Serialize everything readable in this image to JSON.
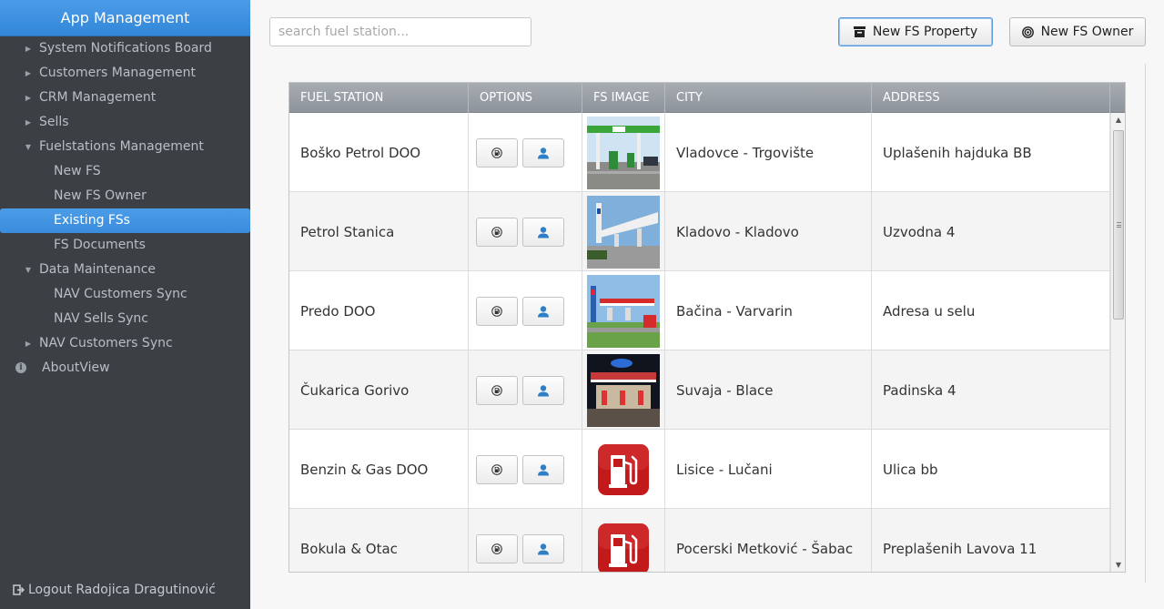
{
  "sidebar": {
    "title": "App Management",
    "items": [
      {
        "label": "System Notifications Board",
        "type": "collapsed"
      },
      {
        "label": "Customers Management",
        "type": "collapsed"
      },
      {
        "label": "CRM Management",
        "type": "collapsed"
      },
      {
        "label": "Sells",
        "type": "collapsed"
      },
      {
        "label": "Fuelstations Management",
        "type": "expanded"
      },
      {
        "label": "New FS",
        "type": "sub"
      },
      {
        "label": "New FS Owner",
        "type": "sub"
      },
      {
        "label": "Existing FSs",
        "type": "sub",
        "active": true
      },
      {
        "label": "FS Documents",
        "type": "sub"
      },
      {
        "label": "Data Maintenance",
        "type": "expanded"
      },
      {
        "label": "NAV Customers Sync",
        "type": "sub"
      },
      {
        "label": "NAV Sells Sync",
        "type": "sub"
      },
      {
        "label": "NAV Customers Sync",
        "type": "collapsed"
      },
      {
        "label": "AboutView",
        "type": "info"
      }
    ],
    "logout_label": "Logout Radojica Dragutinović"
  },
  "toolbar": {
    "search_placeholder": "search fuel station...",
    "new_property_label": "New FS Property",
    "new_owner_label": "New FS Owner"
  },
  "table": {
    "columns": [
      "FUEL STATION",
      "OPTIONS",
      "FS IMAGE",
      "CITY",
      "ADDRESS"
    ],
    "rows": [
      {
        "station": "Boško Petrol DOO",
        "image": "photo-station-green",
        "city": "Vladovce - Trgovište",
        "address": "Uplašenih hajduka BB"
      },
      {
        "station": "Petrol Stanica",
        "image": "photo-station-white",
        "city": "Kladovo - Kladovo",
        "address": "Uzvodna 4"
      },
      {
        "station": "Predo DOO",
        "image": "photo-station-red",
        "city": "Bačina - Varvarin",
        "address": "Adresa u selu"
      },
      {
        "station": "Čukarica Gorivo",
        "image": "photo-station-night",
        "city": "Suvaja - Blace",
        "address": "Padinska 4"
      },
      {
        "station": "Benzin & Gas DOO",
        "image": "fuel-pump-icon",
        "city": "Lisice - Lučani",
        "address": "Ulica bb"
      },
      {
        "station": "Bokula & Otac",
        "image": "fuel-pump-icon",
        "city": "Pocerski Metković - Šabac",
        "address": "Preplašenih Lavova 11"
      }
    ]
  },
  "colors": {
    "sidebar_bg": "#3c4045",
    "accent": "#3a8ddd",
    "header_gray": "#9ba0a7",
    "user_icon": "#2f7fc6",
    "pump_red": "#c2191b"
  }
}
